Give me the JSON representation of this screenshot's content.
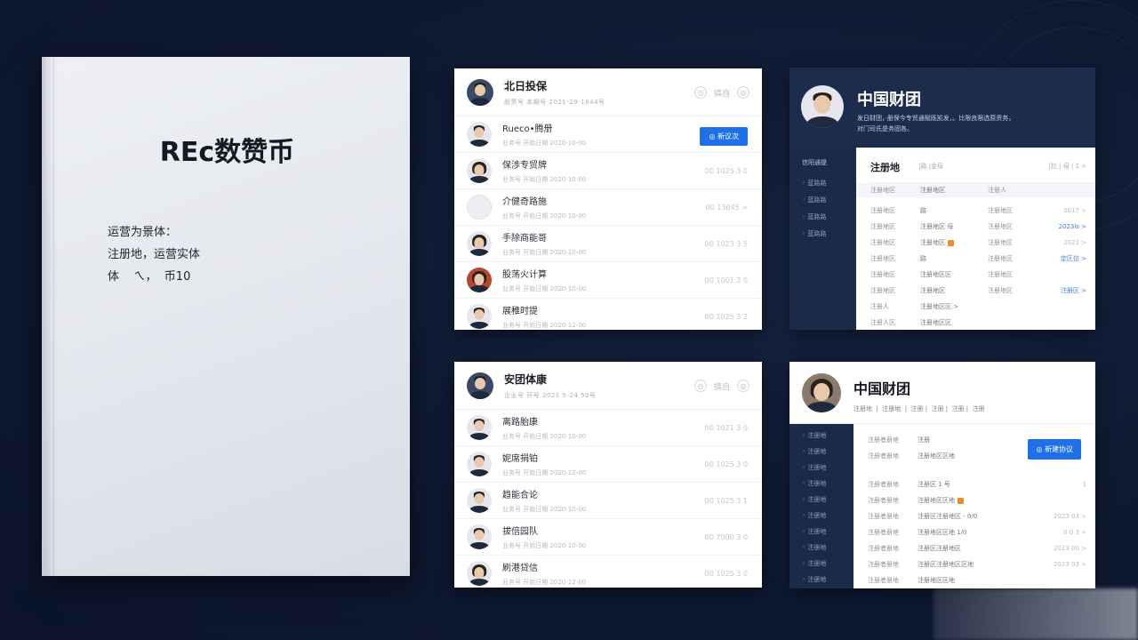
{
  "document": {
    "title": "REc数赞币",
    "lines": [
      "运营为景体：",
      "注册地，运营实体",
      "体    ㄟ，  币10"
    ]
  },
  "card_list_1": {
    "title": "北日投保",
    "subtitle": "股票号    本期号      2021-29-1844号",
    "action_label": "搞自",
    "button_label": "◎ 新议次",
    "rows": [
      {
        "name": "Rueco•腾册",
        "meta": "业务号     开始日期       2020-10-00",
        "right": ""
      },
      {
        "name": "保涉专贸牌",
        "meta": "业务号     开始日期       2020-10-00",
        "right": "00 1025 3 0"
      },
      {
        "name": "介健奇路施",
        "meta": "业务号     开始日期       2020-10-00",
        "right": "00 13045 >"
      },
      {
        "name": "手除商能哥",
        "meta": "业务号     开始日期       2020-10-00",
        "right": "00 1023 3 5"
      },
      {
        "name": "股荡火计算",
        "meta": "业务号     开始日期       2020-10-00",
        "right": "00 1001 3 0"
      },
      {
        "name": "展稚时提",
        "meta": "业务号     开始日期       2020-12-00",
        "right": "00 1025 3 2"
      }
    ]
  },
  "card_list_2": {
    "title": "安团体康",
    "subtitle": "企业号    开号      2021 5-24 50号",
    "action_label": "搞自",
    "rows": [
      {
        "name": "离路胎康",
        "meta": "业务号     开始日期       2020-10-00",
        "right": "00 1021 3 0"
      },
      {
        "name": "妮席捐铂",
        "meta": "业务号     开始日期       2020-12-00",
        "right": "00 1025 3 0"
      },
      {
        "name": "趋能合论",
        "meta": "业务号     开始日期       2020-10-00",
        "right": "00 1025 3 1"
      },
      {
        "name": "拔倍园队",
        "meta": "业务号     开始日期       2020-10-00",
        "right": "00 7000 3 0"
      },
      {
        "name": "刷港贷信",
        "meta": "业务号     开始日期       2020-12-00",
        "right": "00 1025 3 0"
      }
    ]
  },
  "card_profile_1": {
    "company": "中国财团",
    "desc_line1": "发日财团，·册保今专贸通赋既凯发，。比限良限选原资务，",
    "desc_line2": "对门司氏是务固各。",
    "sidebar": [
      "信阳通提",
      "◦ 蓝路路",
      "◦ 蓝路路",
      "◦ 蓝路路",
      "◦ 蓝路路"
    ],
    "section_title": "注册地",
    "header_tabs": "|路  |金母",
    "header_right": "|拉 | 母   | 1 >",
    "columns": [
      "注册地区",
      "注册地区",
      "注册人"
    ],
    "rows": [
      {
        "k": "注册地区",
        "v": "路",
        "v2": "注册地区",
        "r": "2017 >",
        "r_type": "gray"
      },
      {
        "k": "注册地区",
        "v": "注册地区 母",
        "v2": "注册地区",
        "r": "2023ls >",
        "r_type": "link"
      },
      {
        "k": "注册地区",
        "v": "注册地区",
        "v2": "注册地区",
        "r": "2022 >",
        "r_type": "gray",
        "tag": true
      },
      {
        "k": "注册地区",
        "v": "路",
        "v2": "注册地区",
        "r": "定区位 >",
        "r_type": "link"
      },
      {
        "k": "注册地区",
        "v": "注册地区区",
        "v2": "注册地区",
        "r": "",
        "r_type": "gray"
      },
      {
        "k": "注册地区",
        "v": "注册地区",
        "v2": "注册地区",
        "r": "注册区 >",
        "r_type": "link"
      },
      {
        "k": "注册人",
        "v": "注册地区区 >",
        "v2": "",
        "r": "",
        "r_type": "gray"
      },
      {
        "k": "注册人区",
        "v": "注册地区区",
        "v2": "",
        "r": "",
        "r_type": "gray"
      }
    ]
  },
  "card_profile_2": {
    "company": "中国财团",
    "tabs": "注册地  |  注册地  |  注册 |  注册 |  注册 |  注册",
    "button_label": "◎ 新建协议",
    "sidebar": [
      "◦ 注册地",
      "◦ 注册地",
      "◦ 注册地",
      "◦ 注册地",
      "◦ 注册地",
      "◦ 注册地",
      "◦ 注册地",
      "◦ 注册地",
      "◦ 注册地",
      "◦ 注册地"
    ],
    "top_rows": [
      {
        "k": "注册者册地",
        "v": "注册"
      },
      {
        "k": "注册者册地",
        "v": "注册地区区地"
      }
    ],
    "rows": [
      {
        "k": "注册者册地",
        "v": "注册区 1 号",
        "r": "1",
        "r_type": "gray"
      },
      {
        "k": "注册者册地",
        "v": "注册地区区地",
        "r": "",
        "r_type": "gray",
        "tag": true
      },
      {
        "k": "注册者册地",
        "v": "注册区注册地区 - 0/0",
        "r": "2023 03 >",
        "r_type": "gray"
      },
      {
        "k": "注册者册地",
        "v": "注册地区区地  1/0",
        "r": "0 0 3 >",
        "r_type": "gray"
      },
      {
        "k": "注册者册地",
        "v": "注册区注册地区",
        "r": "2023 00 >",
        "r_type": "gray"
      },
      {
        "k": "注册者册地",
        "v": "注册区注册地区区地",
        "r": "2023 03 >",
        "r_type": "gray"
      },
      {
        "k": "注册者册地",
        "v": "注册地区区地",
        "r": "",
        "r_type": "gray"
      }
    ]
  },
  "colors": {
    "background": "#0f1a33",
    "accent_blue": "#1f6fe8",
    "sidebar_dark": "#1b2a48",
    "tag_orange": "#f08a24"
  }
}
